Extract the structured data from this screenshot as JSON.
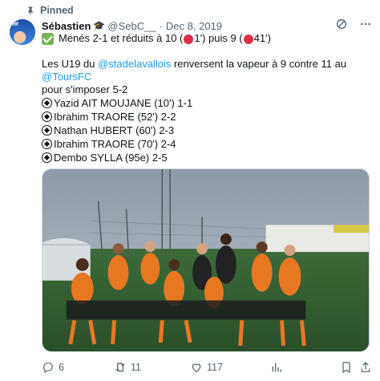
{
  "pinned_label": "Pinned",
  "author": {
    "name": "Sébastien",
    "cap_emoji": "🎓",
    "handle": "@SebC__",
    "separator": "·",
    "date": "Dec 8, 2019"
  },
  "tweet": {
    "line1_a": "Menés 2-1 et réduits à 10 (",
    "line1_b": "1') puis 9 (",
    "line1_c": "41')",
    "para_a": "Les U19 du ",
    "mention1": "@stadelavallois",
    "para_b": " renversent la vapeur à 9 contre 11 au ",
    "mention2": "@ToursFC",
    "para_c": "pour s'imposer 5-2",
    "scorers": [
      "Yazid AIT MOUJANE (10') 1-1",
      "Ibrahim TRAORE (52') 2-2",
      "Nathan HUBERT (60') 2-3",
      "Ibrahim TRAORE (70') 2-4",
      "Dembo SYLLA (95e) 2-5"
    ]
  },
  "actions": {
    "replies": "6",
    "retweets": "11",
    "likes": "117"
  },
  "colors": {
    "link": "#1d9bf0",
    "muted": "#536471",
    "red_card": "#dd2e44",
    "check": "#77b255"
  }
}
